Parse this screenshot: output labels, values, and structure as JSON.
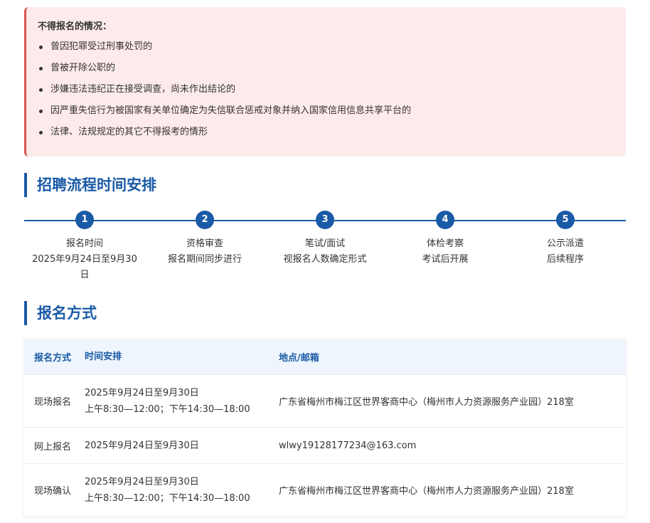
{
  "restrictions": {
    "title": "不得报名的情况：",
    "items": [
      "曾因犯罪受过刑事处罚的",
      "曾被开除公职的",
      "涉嫌违法违纪正在接受调查，尚未作出结论的",
      "因严重失信行为被国家有关单位确定为失信联合惩戒对象并纳入国家信用信息共享平台的",
      "法律、法规规定的其它不得报考的情形"
    ]
  },
  "process": {
    "title": "招聘流程时间安排",
    "steps": [
      {
        "num": "1",
        "label": "报名时间",
        "detail": "2025年9月24日至9月30日"
      },
      {
        "num": "2",
        "label": "资格审查",
        "detail": "报名期间同步进行"
      },
      {
        "num": "3",
        "label": "笔试/面试",
        "detail": "视报名人数确定形式"
      },
      {
        "num": "4",
        "label": "体检考察",
        "detail": "考试后开展"
      },
      {
        "num": "5",
        "label": "公示派遣",
        "detail": "后续程序"
      }
    ]
  },
  "registration": {
    "title": "报名方式",
    "headers": {
      "method": "报名方式",
      "time": "时间安排",
      "place": "地点/邮箱"
    },
    "rows": [
      {
        "method": "现场报名",
        "date": "2025年9月24日至9月30日",
        "hours": "上午8:30—12:00；下午14:30—18:00",
        "place": "广东省梅州市梅江区世界客商中心（梅州市人力资源服务产业园）218室"
      },
      {
        "method": "网上报名",
        "date": "2025年9月24日至9月30日",
        "hours": "",
        "place": "wlwy19128177234@163.com"
      },
      {
        "method": "现场确认",
        "date": "2025年9月24日至9月30日",
        "hours": "上午8:30—12:00；下午14:30—18:00",
        "place": "广东省梅州市梅江区世界客商中心（梅州市人力资源服务产业园）218室"
      }
    ]
  }
}
